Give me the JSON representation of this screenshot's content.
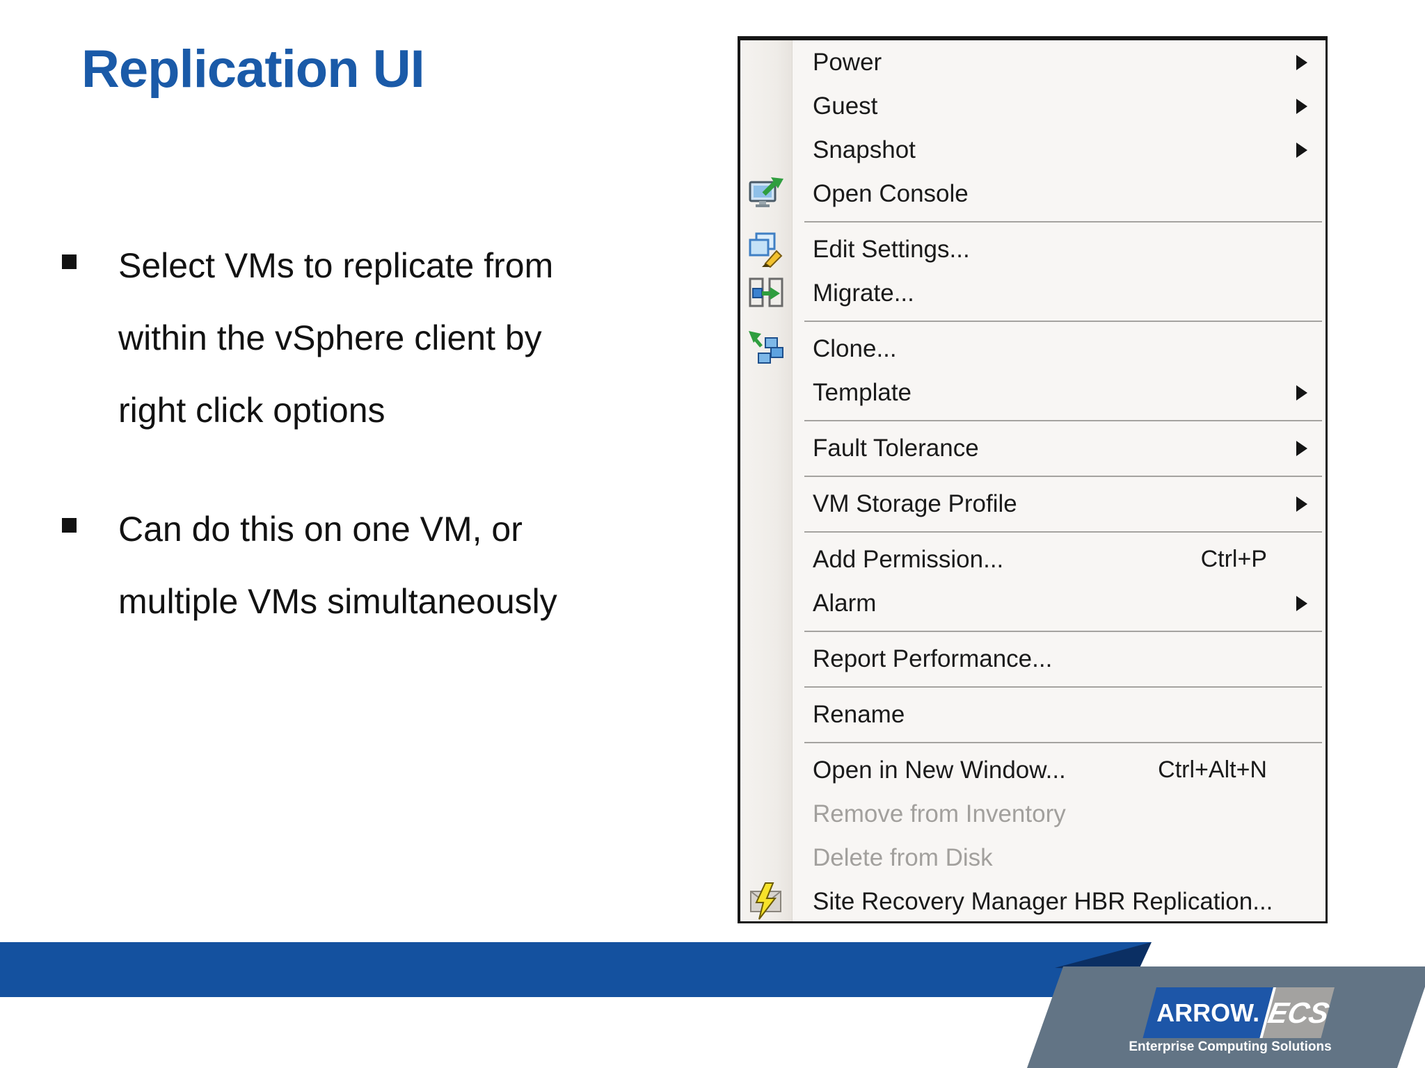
{
  "slide": {
    "title": "Replication UI",
    "bullets": [
      {
        "lines": [
          "Select VMs to replicate from",
          "within the vSphere client by",
          "right click options"
        ]
      },
      {
        "lines": [
          "Can do this on one VM, or",
          "multiple VMs simultaneously"
        ]
      }
    ]
  },
  "context_menu": {
    "items": [
      {
        "label": "Power",
        "has_submenu": true
      },
      {
        "label": "Guest",
        "has_submenu": true
      },
      {
        "label": "Snapshot",
        "has_submenu": true
      },
      {
        "label": "Open Console",
        "icon": "console-icon"
      },
      {
        "label": "Edit Settings...",
        "icon": "edit-settings-icon"
      },
      {
        "label": "Migrate...",
        "icon": "migrate-icon"
      },
      {
        "label": "Clone...",
        "icon": "clone-icon"
      },
      {
        "label": "Template",
        "has_submenu": true
      },
      {
        "label": "Fault Tolerance",
        "has_submenu": true
      },
      {
        "label": "VM Storage Profile",
        "has_submenu": true
      },
      {
        "label": "Add Permission...",
        "shortcut": "Ctrl+P"
      },
      {
        "label": "Alarm",
        "has_submenu": true
      },
      {
        "label": "Report Performance..."
      },
      {
        "label": "Rename"
      },
      {
        "label": "Open in New Window...",
        "shortcut": "Ctrl+Alt+N"
      },
      {
        "label": "Remove from Inventory",
        "disabled": true
      },
      {
        "label": "Delete from Disk",
        "disabled": true
      },
      {
        "label": "Site Recovery Manager HBR Replication...",
        "icon": "srm-icon"
      }
    ]
  },
  "footer": {
    "logo": {
      "arrow_text": "ARROW.",
      "ecs_text": "ECS",
      "tagline": "Enterprise Computing Solutions"
    }
  },
  "colors": {
    "title_blue": "#1a5aa8",
    "bar_blue": "#14519f",
    "fold_navy": "#0b2f63",
    "slate_gray": "#627485",
    "logo_blue": "#1d56a8",
    "logo_gray": "#a3a2a0",
    "menu_bg": "#f8f6f4",
    "menu_border": "#161616",
    "separator_gray": "#a5a3a0",
    "menu_text": "#1a1a1a",
    "disabled_text": "#a2a09d"
  }
}
